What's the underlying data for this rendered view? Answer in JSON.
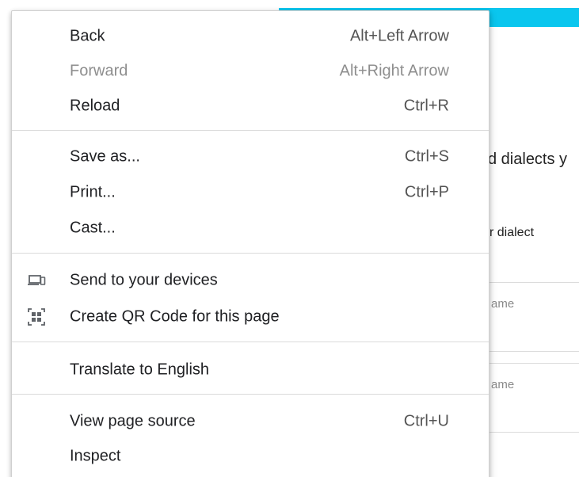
{
  "background_page": {
    "heading_fragment": "d dialects y",
    "label_fragment": "r dialect",
    "field1_placeholder": "ame",
    "field2_placeholder": "ame",
    "accent_color": "#0ac6ee"
  },
  "menu": {
    "items": [
      {
        "label": "Back",
        "shortcut": "Alt+Left Arrow",
        "disabled": false
      },
      {
        "label": "Forward",
        "shortcut": "Alt+Right Arrow",
        "disabled": true
      },
      {
        "label": "Reload",
        "shortcut": "Ctrl+R",
        "disabled": false
      },
      {
        "label": "Save as...",
        "shortcut": "Ctrl+S",
        "disabled": false
      },
      {
        "label": "Print...",
        "shortcut": "Ctrl+P",
        "disabled": false
      },
      {
        "label": "Cast...",
        "shortcut": "",
        "disabled": false
      },
      {
        "label": "Send to your devices",
        "shortcut": "",
        "icon": "devices-icon",
        "disabled": false
      },
      {
        "label": "Create QR Code for this page",
        "shortcut": "",
        "icon": "qr-code-icon",
        "disabled": false
      },
      {
        "label": "Translate to English",
        "shortcut": "",
        "disabled": false
      },
      {
        "label": "View page source",
        "shortcut": "Ctrl+U",
        "disabled": false
      },
      {
        "label": "Inspect",
        "shortcut": "",
        "disabled": false
      }
    ]
  }
}
